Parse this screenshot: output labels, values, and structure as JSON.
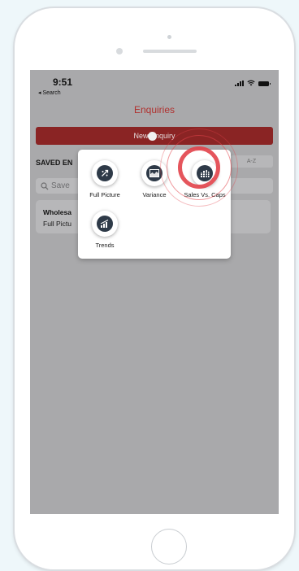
{
  "status_bar": {
    "time": "9:51",
    "back_label": "◂ Search"
  },
  "header": {
    "title": "Enquiries"
  },
  "actions": {
    "new_enquiry_label": "New Enquiry"
  },
  "saved": {
    "section_label": "SAVED EN",
    "sort_label": "A-Z",
    "search_placeholder": "Save",
    "items": [
      {
        "title": "Wholesa",
        "subtitle": "Full Pictu"
      }
    ]
  },
  "menu": {
    "options": [
      {
        "label": "Full Picture",
        "icon": "arrows-diagonal-icon"
      },
      {
        "label": "Variance",
        "icon": "area-chart-icon"
      },
      {
        "label": "Sales Vs. Caps",
        "icon": "bar-grid-icon",
        "highlighted": true
      },
      {
        "label": "Trends",
        "icon": "bar-chart-icon"
      }
    ]
  },
  "colors": {
    "accent": "#b0302e",
    "button_bg": "#8a2424",
    "ripple": "#e2434a",
    "icon_bg": "#2e3a48"
  }
}
